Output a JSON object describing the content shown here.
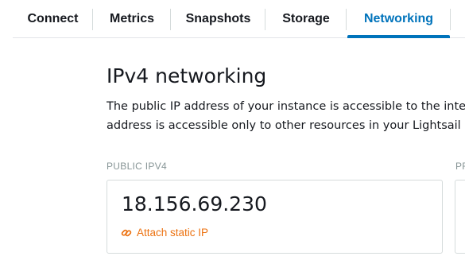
{
  "tabs": [
    {
      "label": "Connect",
      "active": false
    },
    {
      "label": "Metrics",
      "active": false
    },
    {
      "label": "Snapshots",
      "active": false
    },
    {
      "label": "Storage",
      "active": false
    },
    {
      "label": "Networking",
      "active": true
    }
  ],
  "ipv4_section": {
    "title": "IPv4 networking",
    "description_line1": "The public IP address of your instance is accessible to the inter",
    "description_line2": "address is accessible only to other resources in your Lightsail a"
  },
  "public_ipv4": {
    "label": "PUBLIC IPV4",
    "ip_address": "18.156.69.230",
    "attach_static_ip_label": "Attach static IP",
    "attach_icon": "static-ip-link-icon"
  },
  "private_ipv4": {
    "label": "PR"
  },
  "colors": {
    "accent_blue": "#0073bb",
    "link_orange": "#ec7211",
    "label_gray": "#879596",
    "border_gray": "#d5dbdb",
    "text_dark": "#16191f"
  }
}
